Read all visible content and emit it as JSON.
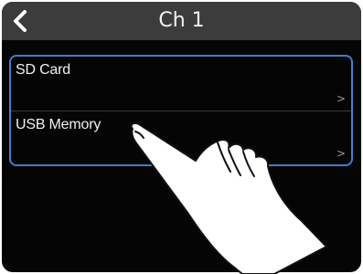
{
  "header": {
    "title": "Ch 1",
    "back_icon": "chevron-left-icon"
  },
  "list": {
    "items": [
      {
        "label": "SD Card",
        "chevron": ">"
      },
      {
        "label": "USB Memory",
        "chevron": ">"
      }
    ]
  },
  "colors": {
    "background": "#050505",
    "topbar": "#3c3c3c",
    "selection_outline": "#3f7fd1",
    "text": "#f0f0f0"
  },
  "overlay": {
    "icon": "pointing-hand-icon"
  }
}
